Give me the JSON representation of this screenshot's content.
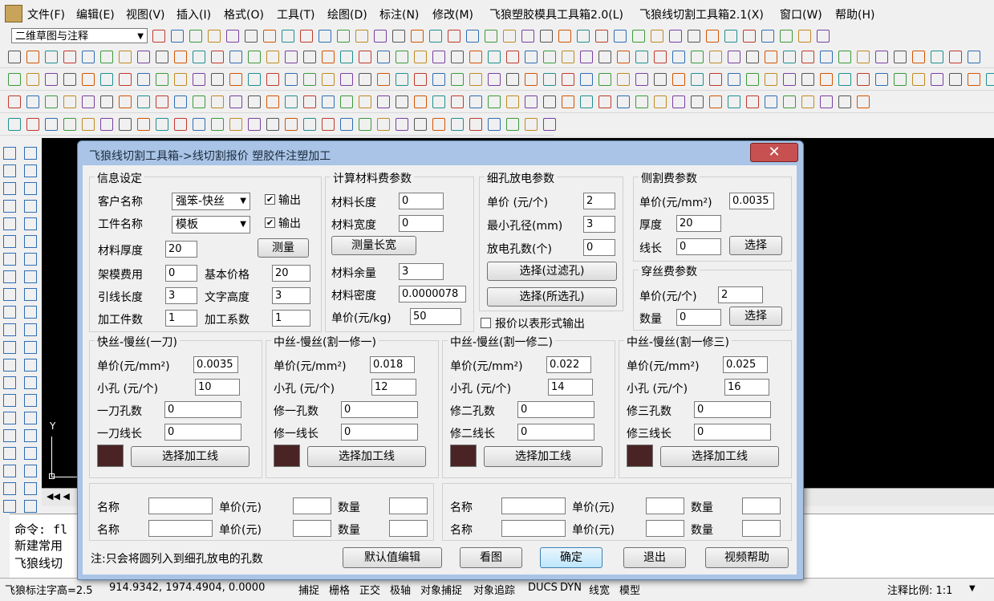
{
  "menu": [
    "文件(F)",
    "编辑(E)",
    "视图(V)",
    "插入(I)",
    "格式(O)",
    "工具(T)",
    "绘图(D)",
    "标注(N)",
    "修改(M)",
    "飞狼塑胶模具工具箱2.0(L)",
    "飞狼线切割工具箱2.1(X)",
    "窗口(W)",
    "帮助(H)"
  ],
  "workspace": "二维草图与注释",
  "canvas": {
    "y_label": "Y"
  },
  "command": {
    "lines": [
      "命令: fl",
      "新建常用",
      "飞狼线切"
    ]
  },
  "status": {
    "left": "飞狼标注字高=2.5",
    "coords": "914.9342,  1974.4904,  0.0000",
    "toggles": [
      "捕捉",
      "栅格",
      "正交",
      "极轴",
      "对象捕捉",
      "对象追踪",
      "DUCS",
      "DYN",
      "线宽",
      "模型"
    ],
    "scale": "注释比例: 1:1"
  },
  "dialog": {
    "title": "飞狼线切割工具箱->线切割报价    塑胶件注塑加工",
    "close": "✕",
    "info": {
      "title": "信息设定",
      "customer_label": "客户名称",
      "customer_value": "强笨-快丝",
      "workpiece_label": "工件名称",
      "workpiece_value": "模板",
      "output_label": "输出",
      "thickness_label": "材料厚度",
      "thickness_value": "20",
      "measure_btn": "测量",
      "frame_label": "架模费用",
      "frame_value": "0",
      "base_price_label": "基本价格",
      "base_price_value": "20",
      "lead_label": "引线长度",
      "lead_value": "3",
      "text_height_label": "文字高度",
      "text_height_value": "3",
      "pieces_label": "加工件数",
      "pieces_value": "1",
      "coef_label": "加工系数",
      "coef_value": "1"
    },
    "material": {
      "title": "计算材料费参数",
      "length_label": "材料长度",
      "length_value": "0",
      "width_label": "材料宽度",
      "width_value": "0",
      "measure_btn": "测量长宽",
      "margin_label": "材料余量",
      "margin_value": "3",
      "density_label": "材料密度",
      "density_value": "0.0000078",
      "unit_label": "单价(元/kg)",
      "unit_value": "50"
    },
    "edm": {
      "title": "细孔放电参数",
      "price_label": "单价 (元/个)",
      "price_value": "2",
      "min_label": "最小孔径(mm)",
      "min_value": "3",
      "count_label": "放电孔数(个)",
      "count_value": "0",
      "btn_filter": "选择(过滤孔)",
      "btn_selected": "选择(所选孔)"
    },
    "report_table": "报价以表形式输出",
    "side": {
      "title": "侧割费参数",
      "price_label": "单价(元/mm²)",
      "price_value": "0.0035",
      "thick_label": "厚度",
      "thick_value": "20",
      "len_label": "线长",
      "len_value": "0",
      "btn": "选择"
    },
    "thread": {
      "title": "穿丝费参数",
      "price_label": "单价(元/个)",
      "price_value": "2",
      "qty_label": "数量",
      "qty_value": "0",
      "btn": "选择"
    },
    "passes": [
      {
        "title": "快丝-慢丝(一刀)",
        "price_label": "单价(元/mm²)",
        "price": "0.0035",
        "hole_label": "小孔 (元/个)",
        "hole": "10",
        "n_label": "一刀孔数",
        "n": "0",
        "l_label": "一刀线长",
        "l": "0",
        "btn": "选择加工线",
        "color": "#4a2424"
      },
      {
        "title": "中丝-慢丝(割一修一)",
        "price_label": "单价(元/mm²)",
        "price": "0.018",
        "hole_label": "小孔 (元/个)",
        "hole": "12",
        "n_label": "修一孔数",
        "n": "0",
        "l_label": "修一线长",
        "l": "0",
        "btn": "选择加工线",
        "color": "#4a2424"
      },
      {
        "title": "中丝-慢丝(割一修二)",
        "price_label": "单价(元/mm²)",
        "price": "0.022",
        "hole_label": "小孔 (元/个)",
        "hole": "14",
        "n_label": "修二孔数",
        "n": "0",
        "l_label": "修二线长",
        "l": "0",
        "btn": "选择加工线",
        "color": "#4a2424"
      },
      {
        "title": "中丝-慢丝(割一修三)",
        "price_label": "单价(元/mm²)",
        "price": "0.025",
        "hole_label": "小孔 (元/个)",
        "hole": "16",
        "n_label": "修三孔数",
        "n": "0",
        "l_label": "修三线长",
        "l": "0",
        "btn": "选择加工线",
        "color": "#4a2424"
      }
    ],
    "extras": {
      "name_label": "名称",
      "price_label": "单价(元)",
      "qty_label": "数量"
    },
    "note": "注:只会将圆列入到细孔放电的孔数",
    "buttons": {
      "defaults": "默认值编辑",
      "view": "看图",
      "ok": "确定",
      "exit": "退出",
      "help": "视频帮助"
    }
  }
}
